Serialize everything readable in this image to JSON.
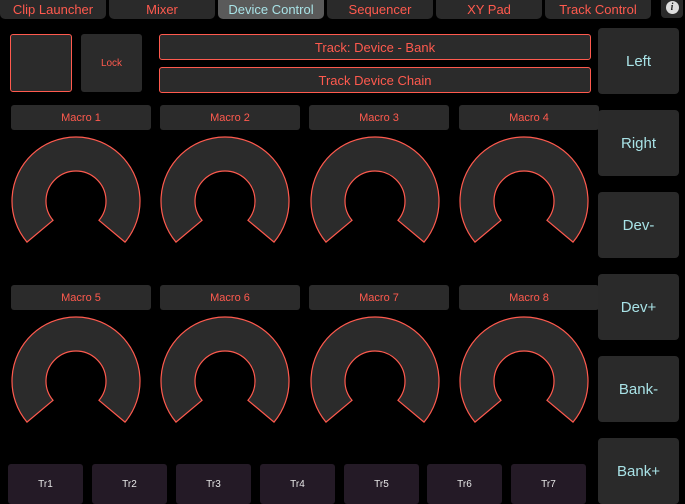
{
  "tabs": [
    {
      "label": "Clip Launcher",
      "active": false
    },
    {
      "label": "Mixer",
      "active": false
    },
    {
      "label": "Device Control",
      "active": true
    },
    {
      "label": "Sequencer",
      "active": false
    },
    {
      "label": "XY Pad",
      "active": false
    },
    {
      "label": "Track Control",
      "active": false
    }
  ],
  "info_icon": "i",
  "lock_label": "Lock",
  "track_device_bank": "Track: Device - Bank",
  "track_device_chain": "Track Device Chain",
  "macros": [
    {
      "label": "Macro 1"
    },
    {
      "label": "Macro 2"
    },
    {
      "label": "Macro 3"
    },
    {
      "label": "Macro 4"
    },
    {
      "label": "Macro 5"
    },
    {
      "label": "Macro 6"
    },
    {
      "label": "Macro 7"
    },
    {
      "label": "Macro 8"
    }
  ],
  "nav_buttons": [
    "Left",
    "Right",
    "Dev-",
    "Dev+",
    "Bank-",
    "Bank+"
  ],
  "tracks": [
    "Tr1",
    "Tr2",
    "Tr3",
    "Tr4",
    "Tr5",
    "Tr6",
    "Tr7"
  ],
  "colors": {
    "accent": "#ff5a4e",
    "active_text": "#a8e2e6",
    "panel": "#2b2b2b",
    "background": "#000000"
  }
}
